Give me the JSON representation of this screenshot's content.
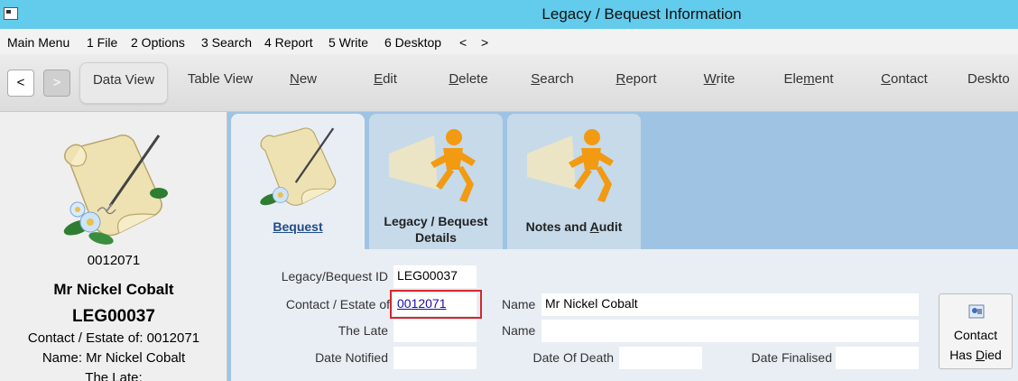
{
  "window": {
    "title": "Legacy / Bequest Information"
  },
  "menu": [
    "Main Menu",
    "1 File",
    "2 Options",
    "3 Search",
    "4 Report",
    "5 Write",
    "6 Desktop",
    "<",
    ">"
  ],
  "toolbar": {
    "back": "<",
    "forward": ">",
    "buttons": [
      {
        "label": "Data View"
      },
      {
        "label": "Table View"
      },
      {
        "pre": "",
        "u": "N",
        "post": "ew"
      },
      {
        "pre": "",
        "u": "E",
        "post": "dit"
      },
      {
        "pre": "",
        "u": "D",
        "post": "elete"
      },
      {
        "pre": "",
        "u": "S",
        "post": "earch"
      },
      {
        "pre": "",
        "u": "R",
        "post": "eport"
      },
      {
        "pre": "",
        "u": "W",
        "post": "rite"
      },
      {
        "pre": "Ele",
        "u": "m",
        "post": "ent"
      },
      {
        "pre": "",
        "u": "C",
        "post": "ontact"
      },
      {
        "label": "Deskto"
      }
    ]
  },
  "sidebar": {
    "contact_no": "0012071",
    "name": "Mr Nickel Cobalt",
    "legacy_id": "LEG00037",
    "contact_line": "Contact / Estate of: 0012071",
    "name_line": "Name: Mr Nickel Cobalt",
    "late_line": "The Late:"
  },
  "tabs": [
    {
      "label": "Bequest"
    },
    {
      "label_line1": "Legacy / Bequest",
      "label_line2": "Details"
    },
    {
      "pre": "Notes and ",
      "u": "A",
      "post": "udit"
    }
  ],
  "form": {
    "legacy_id_label": "Legacy/Bequest ID",
    "legacy_id_value": "LEG00037",
    "contact_label": "Contact / Estate of",
    "contact_value": "0012071",
    "name_label": "Name",
    "name_value": "Mr Nickel Cobalt",
    "late_label": "The Late",
    "late_value": "",
    "name2_label": "Name",
    "name2_value": "",
    "date_notified_label": "Date Notified",
    "date_notified_value": "",
    "date_of_death_label": "Date Of Death",
    "date_of_death_value": "",
    "date_finalised_label": "Date Finalised",
    "date_finalised_value": "",
    "died_button_line1": "Contact",
    "died_button_pre": "Has ",
    "died_button_u": "D",
    "died_button_post": "ied"
  }
}
